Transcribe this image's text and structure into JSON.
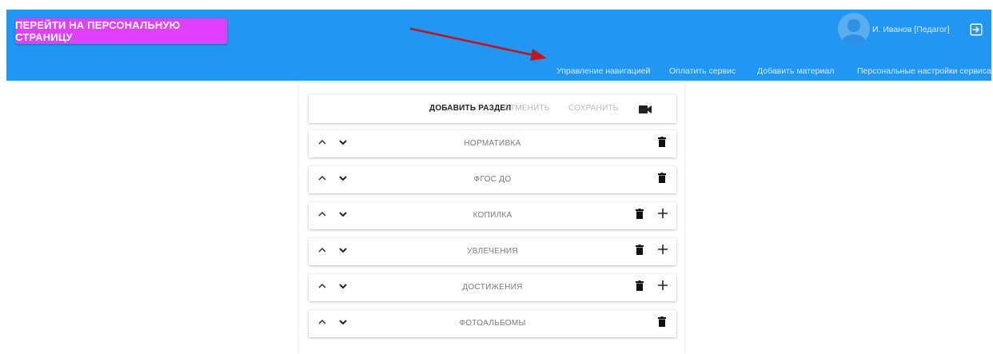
{
  "header": {
    "personal_page_button": "ПЕРЕЙТИ НА ПЕРСОНАЛЬНУЮ СТРАНИЦУ",
    "user_name": "И. Иванов [Педагог]",
    "nav": [
      "Управление навигацией",
      "Оплатить сервис",
      "Добавить материал",
      "Персональные настройки сервиса"
    ]
  },
  "toolbar": {
    "add_section": "ДОБАВИТЬ РАЗДЕЛ",
    "cancel": "ОТМЕНИТЬ",
    "save": "СОХРАНИТЬ"
  },
  "sections": [
    {
      "title": "НОРМАТИВКА",
      "has_add": false
    },
    {
      "title": "ФГОС ДО",
      "has_add": false
    },
    {
      "title": "КОПИЛКА",
      "has_add": true
    },
    {
      "title": "УВЛЕЧЕНИЯ",
      "has_add": true
    },
    {
      "title": "ДОСТИЖЕНИЯ",
      "has_add": true
    },
    {
      "title": "ФОТОАЛЬБОМЫ",
      "has_add": false
    }
  ],
  "icons": {
    "avatar": "user-avatar-icon",
    "logout": "logout-icon",
    "video": "video-camera-icon",
    "move_up": "chevron-up-icon",
    "move_down": "chevron-down-icon",
    "delete": "trash-icon",
    "add": "plus-icon"
  },
  "colors": {
    "header": "#2196f3",
    "personal_button": "#e040fb",
    "annotation_arrow": "#c0161b"
  }
}
